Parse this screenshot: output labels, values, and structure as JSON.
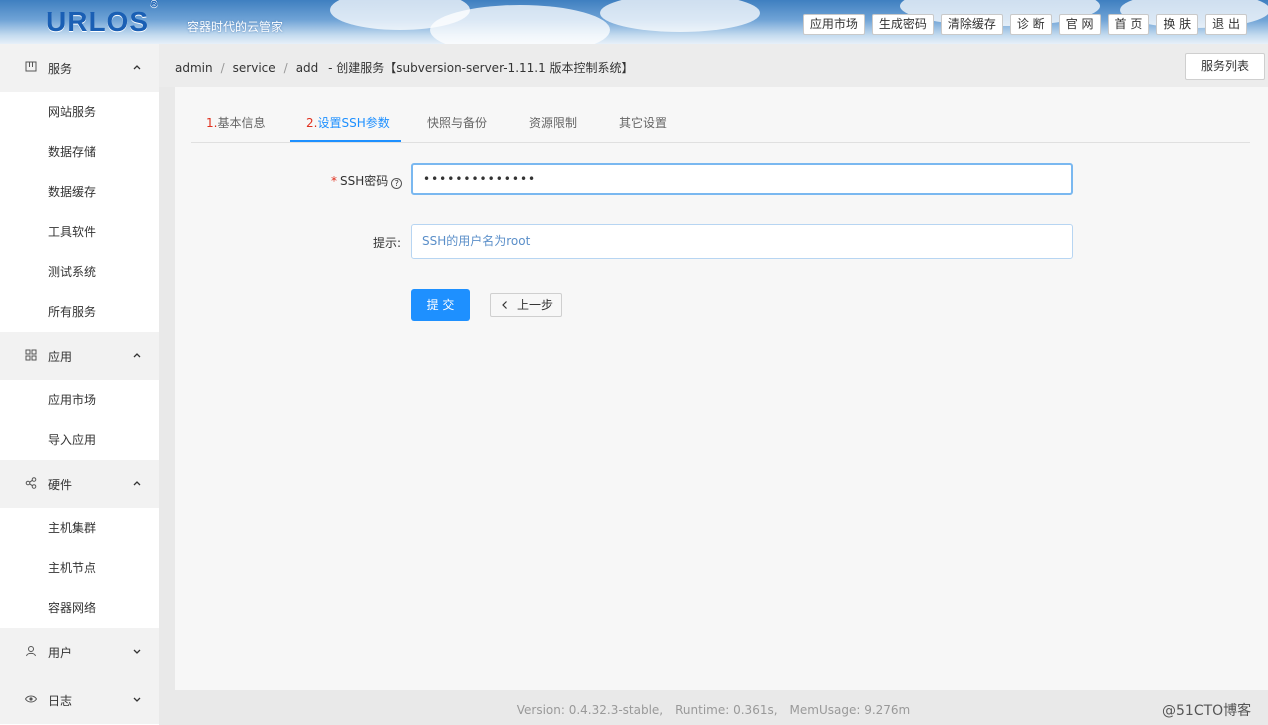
{
  "header": {
    "logo": "URLOS",
    "logo_mark": "®",
    "slogan": "容器时代的云管家",
    "buttons": [
      "应用市场",
      "生成密码",
      "清除缓存",
      "诊 断",
      "官 网",
      "首 页",
      "换 肤",
      "退 出"
    ]
  },
  "sidebar": {
    "groups": [
      {
        "label": "服务",
        "icon": "grid-icon",
        "expanded": true,
        "items": [
          "网站服务",
          "数据存储",
          "数据缓存",
          "工具软件",
          "测试系统",
          "所有服务"
        ]
      },
      {
        "label": "应用",
        "icon": "apps-icon",
        "expanded": true,
        "items": [
          "应用市场",
          "导入应用"
        ]
      },
      {
        "label": "硬件",
        "icon": "share-icon",
        "expanded": true,
        "items": [
          "主机集群",
          "主机节点",
          "容器网络"
        ]
      },
      {
        "label": "用户",
        "icon": "user-icon",
        "expanded": false,
        "items": []
      },
      {
        "label": "日志",
        "icon": "eye-icon",
        "expanded": false,
        "items": []
      }
    ]
  },
  "breadcrumb": {
    "items": [
      "admin",
      "service",
      "add"
    ],
    "separator": "/",
    "title": "-  创建服务【subversion-server-1.11.1 版本控制系统】"
  },
  "service_list_button": "服务列表",
  "tabs": [
    {
      "num": "1.",
      "label": "基本信息",
      "active": false
    },
    {
      "num": "2.",
      "label": "设置SSH参数",
      "active": true
    },
    {
      "num": "",
      "label": "快照与备份",
      "active": false
    },
    {
      "num": "",
      "label": "资源限制",
      "active": false
    },
    {
      "num": "",
      "label": "其它设置",
      "active": false
    }
  ],
  "form": {
    "ssh_password_label": "SSH密码",
    "required_mark": "*",
    "help_mark": "?",
    "ssh_password_value": "••••••••••••••",
    "hint_label": "提示:",
    "hint_value": "SSH的用户名为root",
    "submit_label": "提 交",
    "prev_label": "上一步"
  },
  "footer": {
    "version": "Version: 0.4.32.3-stable,",
    "runtime": "Runtime: 0.361s,",
    "memusage": "MemUsage: 9.276m"
  },
  "watermark": "@51CTO博客",
  "colors": {
    "accent": "#1e90ff",
    "required": "#e0301e",
    "logo": "#1a5fb4"
  }
}
